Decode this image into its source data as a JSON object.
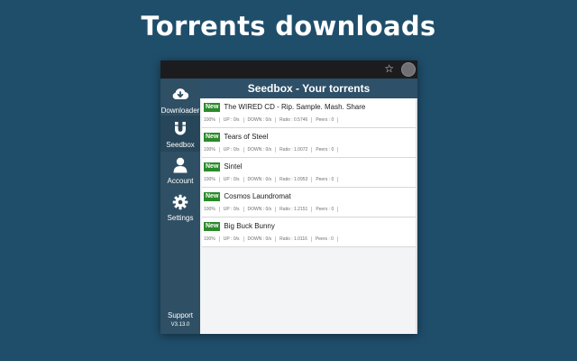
{
  "headline": "Torrents downloads",
  "browser": {
    "star_icon": "star-icon",
    "avatar": "profile-avatar"
  },
  "sidebar": {
    "items": [
      {
        "label": "Downloader",
        "icon": "cloud-download-icon"
      },
      {
        "label": "Seedbox",
        "icon": "magnet-icon"
      },
      {
        "label": "Account",
        "icon": "user-icon"
      },
      {
        "label": "Settings",
        "icon": "gear-icon"
      }
    ],
    "active_index": 1,
    "support_label": "Support",
    "version": "V3.13.0"
  },
  "main": {
    "title": "Seedbox - Your torrents",
    "torrents": [
      {
        "badge": "New",
        "name": "The WIRED CD - Rip. Sample. Mash. Share",
        "progress": "100%",
        "up": "UP : 0/s",
        "down": "DOWN : 0/s",
        "ratio": "Ratio : 0.5746",
        "peers": "Peers : 0"
      },
      {
        "badge": "New",
        "name": "Tears of Steel",
        "progress": "100%",
        "up": "UP : 0/s",
        "down": "DOWN : 0/s",
        "ratio": "Ratio : 1.0072",
        "peers": "Peers : 0"
      },
      {
        "badge": "New",
        "name": "Sintel",
        "progress": "100%",
        "up": "UP : 0/s",
        "down": "DOWN : 0/s",
        "ratio": "Ratio : 1.0953",
        "peers": "Peers : 0"
      },
      {
        "badge": "New",
        "name": "Cosmos Laundromat",
        "progress": "100%",
        "up": "UP : 0/s",
        "down": "DOWN : 0/s",
        "ratio": "Ratio : 1.2151",
        "peers": "Peers : 0"
      },
      {
        "badge": "New",
        "name": "Big Buck Bunny",
        "progress": "100%",
        "up": "UP : 0/s",
        "down": "DOWN : 0/s",
        "ratio": "Ratio : 1.0116",
        "peers": "Peers : 0"
      }
    ]
  },
  "colors": {
    "background": "#1f4e6b",
    "header": "#2e5068",
    "badge": "#2a8a2a"
  }
}
